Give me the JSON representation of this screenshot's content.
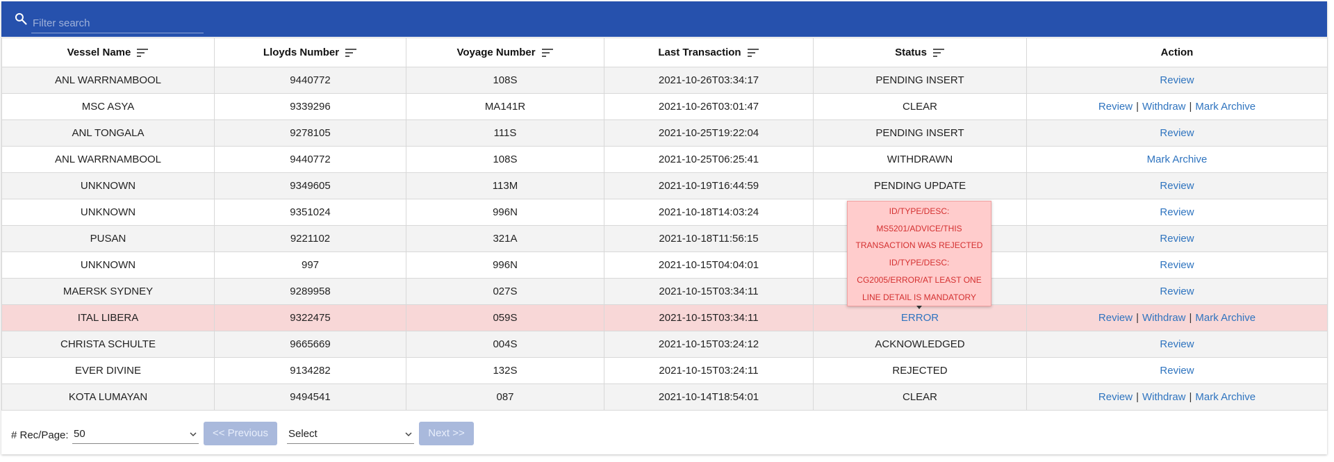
{
  "search": {
    "placeholder": "Filter search",
    "value": ""
  },
  "columns": [
    "Vessel Name",
    "Lloyds Number",
    "Voyage Number",
    "Last Transaction",
    "Status",
    "Action"
  ],
  "rows": [
    {
      "vessel": "ANL WARRNAMBOOL",
      "lloyds": "9440772",
      "voyage": "108S",
      "last": "2021-10-26T03:34:17",
      "status": "PENDING INSERT",
      "actions": [
        "Review"
      ]
    },
    {
      "vessel": "MSC ASYA",
      "lloyds": "9339296",
      "voyage": "MA141R",
      "last": "2021-10-26T03:01:47",
      "status": "CLEAR",
      "actions": [
        "Review",
        "Withdraw",
        "Mark Archive"
      ]
    },
    {
      "vessel": "ANL TONGALA",
      "lloyds": "9278105",
      "voyage": "111S",
      "last": "2021-10-25T19:22:04",
      "status": "PENDING INSERT",
      "actions": [
        "Review"
      ]
    },
    {
      "vessel": "ANL WARRNAMBOOL",
      "lloyds": "9440772",
      "voyage": "108S",
      "last": "2021-10-25T06:25:41",
      "status": "WITHDRAWN",
      "actions": [
        "Mark Archive"
      ]
    },
    {
      "vessel": "UNKNOWN",
      "lloyds": "9349605",
      "voyage": "113M",
      "last": "2021-10-19T16:44:59",
      "status": "PENDING UPDATE",
      "actions": [
        "Review"
      ]
    },
    {
      "vessel": "UNKNOWN",
      "lloyds": "9351024",
      "voyage": "996N",
      "last": "2021-10-18T14:03:24",
      "status": "",
      "actions": [
        "Review"
      ]
    },
    {
      "vessel": "PUSAN",
      "lloyds": "9221102",
      "voyage": "321A",
      "last": "2021-10-18T11:56:15",
      "status": "",
      "actions": [
        "Review"
      ]
    },
    {
      "vessel": "UNKNOWN",
      "lloyds": "997",
      "voyage": "996N",
      "last": "2021-10-15T04:04:01",
      "status": "",
      "actions": [
        "Review"
      ]
    },
    {
      "vessel": "MAERSK SYDNEY",
      "lloyds": "9289958",
      "voyage": "027S",
      "last": "2021-10-15T03:34:11",
      "status": "",
      "actions": [
        "Review"
      ]
    },
    {
      "vessel": "ITAL LIBERA",
      "lloyds": "9322475",
      "voyage": "059S",
      "last": "2021-10-15T03:34:11",
      "status": "ERROR",
      "actions": [
        "Review",
        "Withdraw",
        "Mark Archive"
      ],
      "highlight": true
    },
    {
      "vessel": "CHRISTA SCHULTE",
      "lloyds": "9665669",
      "voyage": "004S",
      "last": "2021-10-15T03:24:12",
      "status": "ACKNOWLEDGED",
      "actions": [
        "Review"
      ]
    },
    {
      "vessel": "EVER DIVINE",
      "lloyds": "9134282",
      "voyage": "132S",
      "last": "2021-10-15T03:24:11",
      "status": "REJECTED",
      "actions": [
        "Review"
      ]
    },
    {
      "vessel": "KOTA LUMAYAN",
      "lloyds": "9494541",
      "voyage": "087",
      "last": "2021-10-14T18:54:01",
      "status": "CLEAR",
      "actions": [
        "Review",
        "Withdraw",
        "Mark Archive"
      ]
    }
  ],
  "action_separator": "|",
  "tooltip": {
    "lines": [
      "ID/TYPE/DESC:",
      "MS5201/ADVICE/THIS",
      "TRANSACTION WAS REJECTED",
      "ID/TYPE/DESC:",
      "CG2005/ERROR/AT LEAST ONE",
      "LINE DETAIL IS MANDATORY"
    ]
  },
  "pager": {
    "rec_label": "# Rec/Page:",
    "rec_value": "50",
    "prev_label": "<< Previous",
    "page_select": "Select",
    "next_label": "Next >>"
  },
  "colors": {
    "header_bar": "#2651ad",
    "link": "#2f74bf",
    "error_row": "#f8d7d7",
    "tooltip_bg": "#ffcccc",
    "tooltip_text": "#d43030",
    "disabled_button": "#a9b9dc"
  },
  "icons": {
    "search": "search-icon",
    "sort": "sort-icon",
    "dropdown": "chevron-down-icon"
  }
}
